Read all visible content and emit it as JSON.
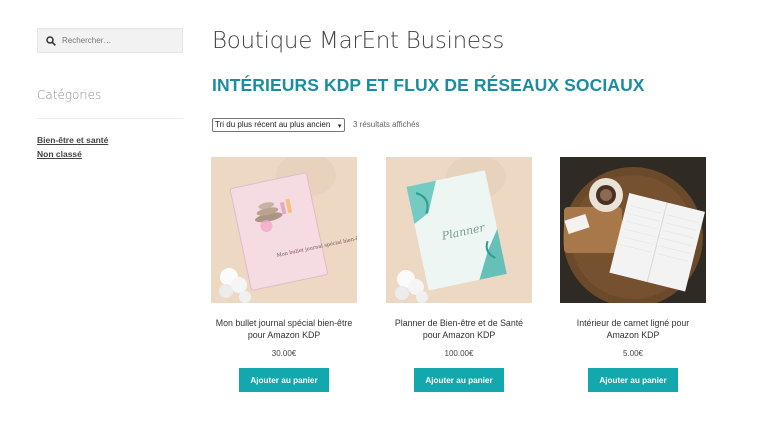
{
  "search": {
    "placeholder": "Rechercher…"
  },
  "sidebar": {
    "title": "Catégories",
    "items": [
      {
        "label": "Bien-être et santé"
      },
      {
        "label": "Non classé"
      }
    ]
  },
  "main": {
    "title": "Boutique MarEnt Business",
    "heading": "INTÉRIEURS KDP ET FLUX DE RÉSEAUX SOCIAUX",
    "sort_label": "Tri du plus récent au plus ancien",
    "result_count": "3 résultats affichés",
    "products": [
      {
        "name": "Mon bullet journal spécial bien-être pour Amazon KDP",
        "price": "30.00€",
        "button": "Ajouter au panier",
        "cover_text": "Mon bullet journal spécial bien-être"
      },
      {
        "name": "Planner de Bien-être et de Santé pour Amazon KDP",
        "price": "100.00€",
        "button": "Ajouter au panier",
        "cover_text": "Planner"
      },
      {
        "name": "Intérieur de carnet ligné pour Amazon KDP",
        "price": "5.00€",
        "button": "Ajouter au panier"
      }
    ]
  },
  "colors": {
    "accent": "#1a8ea0",
    "button": "#12a8ae"
  }
}
